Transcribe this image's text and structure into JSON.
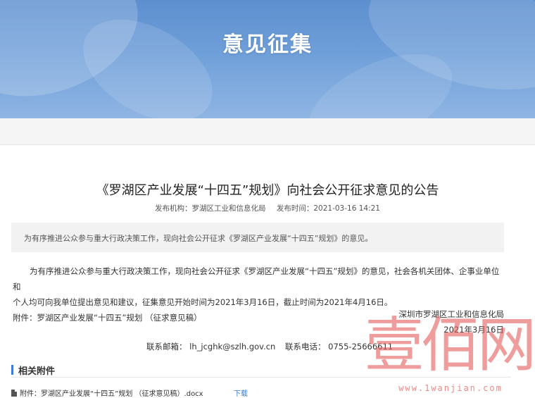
{
  "banner": {
    "title": "意见征集"
  },
  "notice": {
    "title": "《罗湖区产业发展“十四五”规划》向社会公开征求意见的公告",
    "publisher": "发布机构：罗湖区工业和信息化局",
    "publish_time": "发布时间：2021-03-16 14:21",
    "summary": "为有序推进公众参与重大行政决策工作，现向社会公开征求《罗湖区产业发展“十四五”规划》的意见。",
    "body_line1": "为有序推进公众参与重大行政决策工作，现向社会公开征求《罗湖区产业发展“十四五”规划》的意见，社会各机关团体、企事业单位和",
    "body_line2": "个人均可向我单位提出意见和建议，征集意见开始时间为2021年3月16日，截止时间为2021年4月16日。",
    "body_line3": "附件：罗湖区产业发展“十四五”规划 （征求意见稿）",
    "sign_org": "深圳市罗湖区工业和信息化局",
    "sign_date": "2021年3月16日",
    "contact_email": "联系邮箱：  lh_jcghk@szlh.gov.cn",
    "contact_phone": "联系电话：  0755-25666611"
  },
  "attachments": {
    "heading": "相关附件",
    "items": [
      {
        "name": "附件：罗湖区产业发展“十四五”规划 （征求意见稿）.docx",
        "action": "下载",
        "icon": "file-icon"
      }
    ]
  },
  "watermark": {
    "chars": [
      "壹",
      "佰",
      "网"
    ],
    "url": "www.1wanjian.com"
  },
  "colors": {
    "accent": "#3a7bd5",
    "banner": "#6f9fd9",
    "watermark": "#e56060"
  }
}
